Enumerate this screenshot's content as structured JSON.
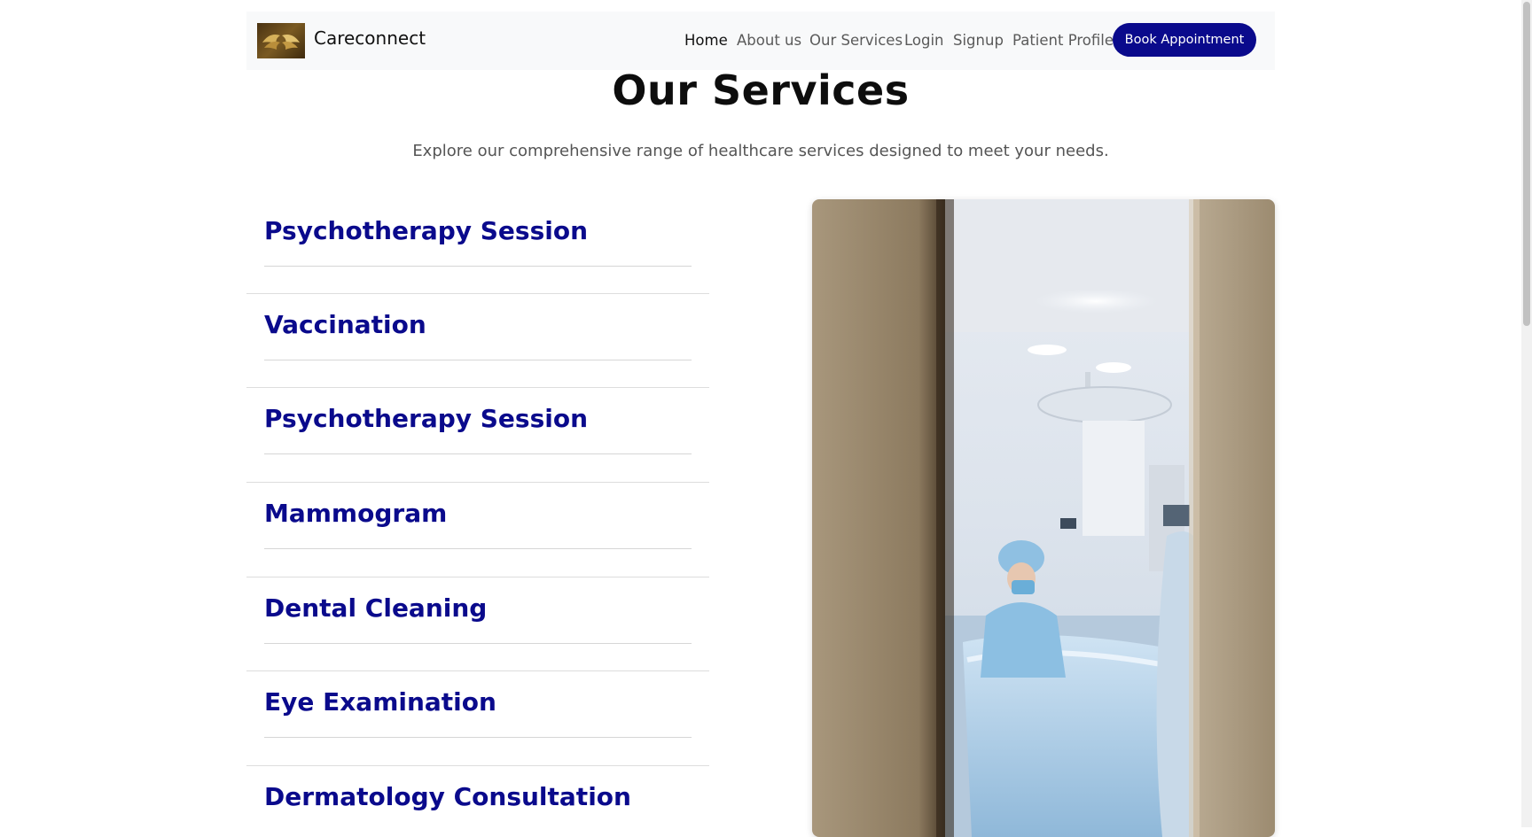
{
  "navbar": {
    "brand": "Careconnect",
    "links": [
      {
        "label": "Home",
        "active": true
      },
      {
        "label": "About us",
        "active": false
      },
      {
        "label": "Our Services",
        "active": false
      },
      {
        "label": "Login",
        "active": false
      },
      {
        "label": "Signup",
        "active": false
      },
      {
        "label": "Patient Profile",
        "active": false
      }
    ],
    "cta_label": "Book Appointment"
  },
  "hero": {
    "title": "Our Services",
    "subtitle": "Explore our comprehensive range of healthcare services designed to meet your needs."
  },
  "services": [
    {
      "name": "Psychotherapy Session"
    },
    {
      "name": "Vaccination"
    },
    {
      "name": "Psychotherapy Session"
    },
    {
      "name": "Mammogram"
    },
    {
      "name": "Dental Cleaning"
    },
    {
      "name": "Eye Examination"
    },
    {
      "name": "Dermatology Consultation"
    }
  ],
  "colors": {
    "accent": "#0a0a8c",
    "navbar_bg": "#f8f9fa",
    "title": "#0d0d0d",
    "muted_text": "#555555"
  },
  "icons": {
    "logo": "golden-wings-logo"
  }
}
